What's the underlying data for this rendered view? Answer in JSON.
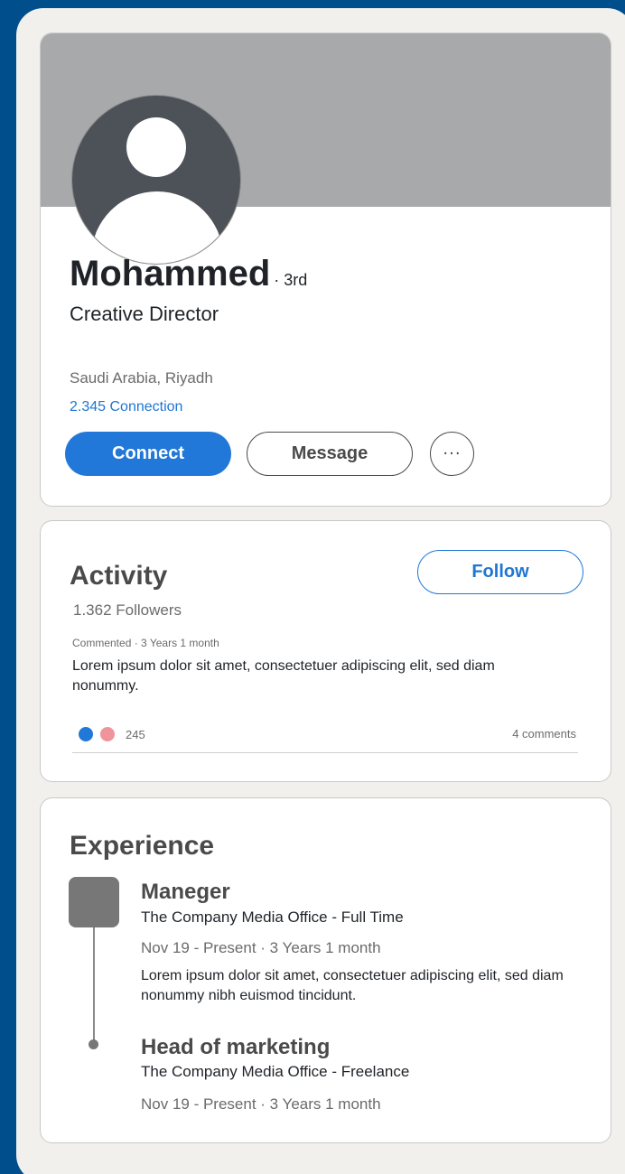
{
  "profile": {
    "name": "Mohammed",
    "degree": "· 3rd",
    "title": "Creative Director",
    "location": "Saudi Arabia, Riyadh",
    "connections": "2.345 Connection",
    "connect_label": "Connect",
    "message_label": "Message",
    "more_label": "···"
  },
  "activity": {
    "title": "Activity",
    "follow_label": "Follow",
    "followers": "1.362 Followers",
    "post": {
      "meta": "Commented · 3 Years 1 month",
      "text": "Lorem ipsum dolor sit amet, consectetuer adipiscing elit, sed diam nonummy.",
      "reaction_count": "245",
      "comments": "4 comments"
    }
  },
  "experience": {
    "title": "Experience",
    "jobs": [
      {
        "title": "Maneger",
        "company": "The Company Media Office - Full Time",
        "dates": "Nov 19 - Present · 3 Years 1 month",
        "description": "Lorem ipsum dolor sit amet, consectetuer adipiscing elit, sed diam nonummy nibh euismod tincidunt."
      },
      {
        "title": "Head of marketing",
        "company": "The Company Media Office - Freelance",
        "dates": "Nov 19 - Present · 3 Years 1 month"
      }
    ]
  },
  "colors": {
    "background": "#004e8c",
    "accent": "#2178d8",
    "cover": "#a7a9ab",
    "reaction_like": "#2178d8",
    "reaction_love": "#f0949b"
  }
}
